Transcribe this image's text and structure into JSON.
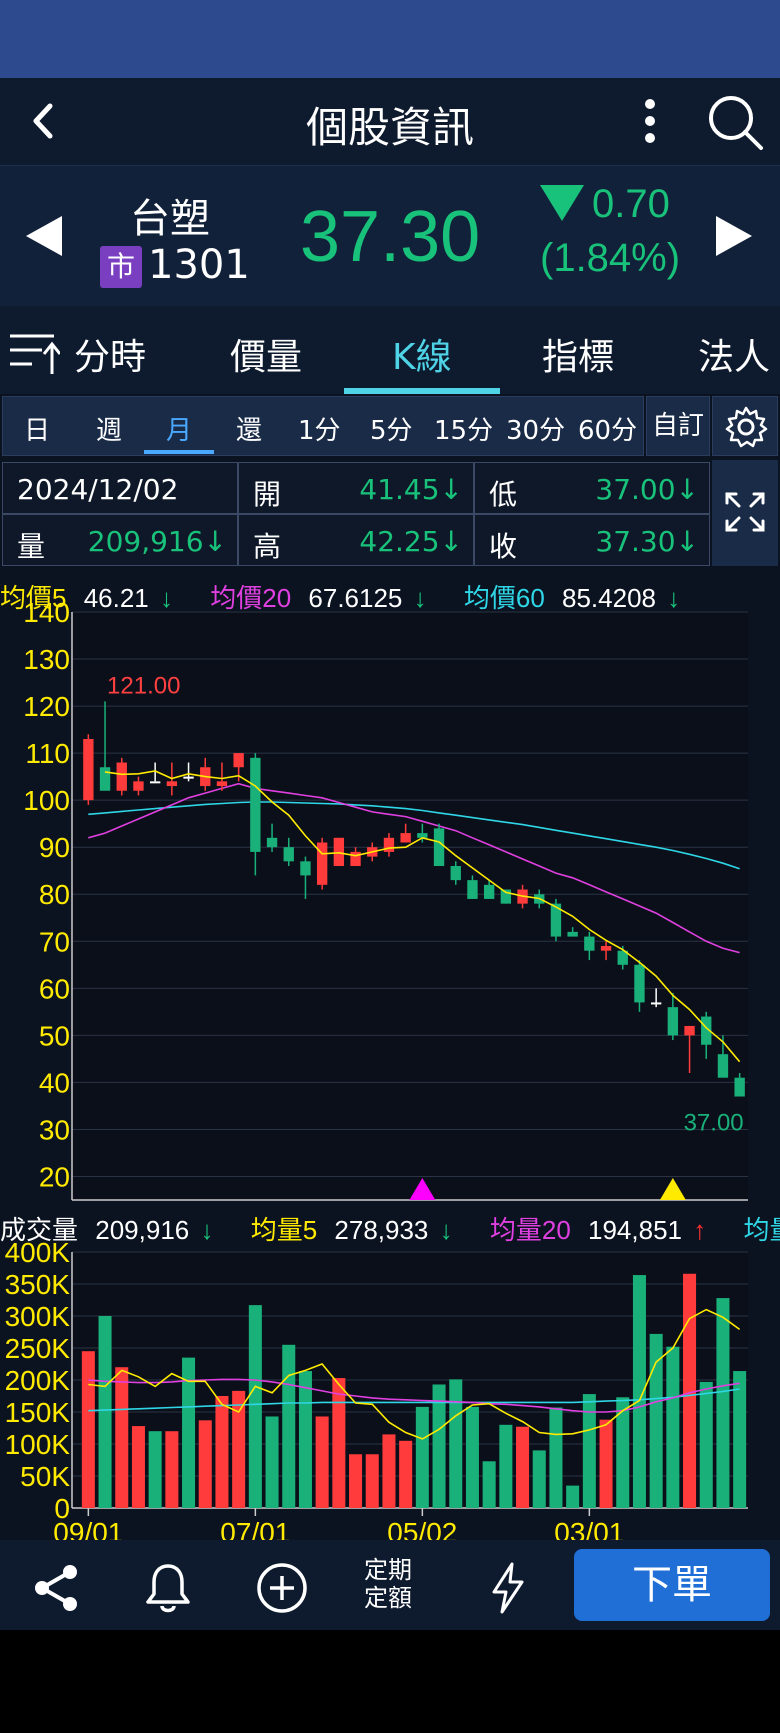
{
  "header": {
    "title": "個股資訊"
  },
  "stock": {
    "name": "台塑",
    "market": "市",
    "code": "1301",
    "price": "37.30",
    "change": "0.70",
    "change_pct": "(1.84%)"
  },
  "tabs": [
    "分時",
    "價量",
    "K線",
    "指標",
    "法人"
  ],
  "active_tab": "K線",
  "periods": [
    "日",
    "週",
    "月",
    "還",
    "1分",
    "5分",
    "15分",
    "30分",
    "60分"
  ],
  "active_period": "月",
  "custom_label": "自訂",
  "info": {
    "date": "2024/12/02",
    "volume_label": "量",
    "volume": "209,916↓",
    "open_label": "開",
    "open": "41.45↓",
    "high_label": "高",
    "high": "42.25↓",
    "low_label": "低",
    "low": "37.00↓",
    "close_label": "收",
    "close": "37.30↓"
  },
  "ma_legend": [
    {
      "label": "均價5",
      "value": "46.21",
      "arrow": "↓",
      "color": "#ffea00"
    },
    {
      "label": "均價20",
      "value": "67.6125",
      "arrow": "↓",
      "color": "#e040e0"
    },
    {
      "label": "均價60",
      "value": "85.4208",
      "arrow": "↓",
      "color": "#2fd6e6"
    }
  ],
  "vol_legend": [
    {
      "label": "成交量",
      "value": "209,916",
      "arrow": "↓",
      "color": "#ffffff",
      "arrow_color": "#19c27a"
    },
    {
      "label": "均量5",
      "value": "278,933",
      "arrow": "↓",
      "color": "#ffea00",
      "arrow_color": "#19c27a"
    },
    {
      "label": "均量20",
      "value": "194,851",
      "arrow": "↑",
      "color": "#e040e0",
      "arrow_color": "#ff3030"
    },
    {
      "label": "均量",
      "value": "",
      "arrow": "",
      "color": "#2fd6e6",
      "arrow_color": "#2fd6e6"
    }
  ],
  "colors": {
    "up": "#ff3b3b",
    "down": "#19b07a",
    "ma5": "#ffea00",
    "ma20": "#e040e0",
    "ma60": "#2fd6e6",
    "axis": "#ffea00"
  },
  "chart_data": {
    "type": "candlestick",
    "price_axis": {
      "min": 15,
      "max": 140,
      "ticks": [
        20,
        30,
        40,
        50,
        60,
        70,
        80,
        90,
        100,
        110,
        120,
        130,
        140
      ]
    },
    "volume_axis": {
      "min": 0,
      "max": 400000,
      "ticks": [
        "0",
        "50K",
        "100K",
        "150K",
        "200K",
        "250K",
        "300K",
        "350K",
        "400K"
      ]
    },
    "x_labels": [
      {
        "label": "09/01",
        "index": 0
      },
      {
        "label": "07/01",
        "index": 10
      },
      {
        "label": "05/02",
        "index": 20
      },
      {
        "label": "03/01",
        "index": 30
      }
    ],
    "annotations": {
      "high": "121.00",
      "low": "37.00"
    },
    "markers": [
      {
        "index": 20,
        "color": "#ff00ff"
      },
      {
        "index": 35,
        "color": "#ffea00"
      }
    ],
    "candles": [
      [
        100,
        114,
        99,
        113
      ],
      [
        107,
        121,
        103,
        102
      ],
      [
        102,
        109,
        101,
        108
      ],
      [
        102,
        105,
        101,
        104
      ],
      [
        104,
        108,
        104,
        104
      ],
      [
        103,
        108,
        101,
        104
      ],
      [
        105,
        108,
        104,
        105
      ],
      [
        103,
        109,
        102,
        107
      ],
      [
        103,
        108,
        102,
        104
      ],
      [
        107,
        110,
        104,
        110
      ],
      [
        109,
        110,
        84,
        89
      ],
      [
        92,
        95,
        89,
        90
      ],
      [
        90,
        92,
        86,
        87
      ],
      [
        87,
        88,
        79,
        84
      ],
      [
        82,
        92,
        81,
        91
      ],
      [
        86,
        92,
        86,
        92
      ],
      [
        86,
        90,
        86,
        89
      ],
      [
        88,
        91,
        87,
        90
      ],
      [
        89,
        93,
        88,
        92
      ],
      [
        91,
        95,
        91,
        93
      ],
      [
        93,
        95,
        91,
        92
      ],
      [
        94,
        95,
        86,
        86
      ],
      [
        86,
        87,
        82,
        83
      ],
      [
        83,
        84,
        79,
        79
      ],
      [
        82,
        83,
        79,
        79
      ],
      [
        81,
        81,
        78,
        78
      ],
      [
        78,
        82,
        77,
        81
      ],
      [
        80,
        81,
        77,
        78
      ],
      [
        78,
        79,
        70,
        71
      ],
      [
        72,
        73,
        71,
        71
      ],
      [
        71,
        72,
        66,
        68
      ],
      [
        68,
        70,
        66,
        69
      ],
      [
        68,
        69,
        64,
        65
      ],
      [
        65,
        66,
        55,
        57
      ],
      [
        57,
        60,
        56,
        57
      ],
      [
        56,
        59,
        49,
        50
      ],
      [
        50,
        52,
        42,
        52
      ],
      [
        54,
        55,
        45,
        48
      ],
      [
        46,
        50,
        41,
        41
      ],
      [
        41,
        42,
        37,
        37
      ]
    ],
    "volume": [
      245000,
      300000,
      220000,
      128000,
      120000,
      120000,
      235000,
      137000,
      175000,
      183000,
      317000,
      143000,
      255000,
      214000,
      143000,
      203000,
      84000,
      84000,
      115000,
      105000,
      158000,
      193000,
      201000,
      158000,
      73000,
      130000,
      127000,
      90000,
      157000,
      35000,
      178000,
      138000,
      173000,
      364000,
      272000,
      252000,
      366000,
      197000,
      328000,
      214000
    ],
    "ma5": [
      null,
      106.0,
      105.5,
      105.6,
      106.2,
      104.6,
      105.6,
      105.0,
      104.6,
      105.2,
      103.0,
      99.6,
      96.8,
      92.4,
      88.6,
      88.8,
      88.2,
      89.0,
      89.8,
      90.0,
      92.0,
      91.1,
      88.2,
      85.6,
      83.0,
      80.4,
      79.6,
      79.1,
      77.3,
      75.3,
      72.5,
      70.2,
      68.2,
      65.5,
      62.6,
      58.5,
      55.5,
      51.6,
      48.6,
      44.4
    ],
    "ma20": [
      92.0,
      93.0,
      94.5,
      96.0,
      97.5,
      99.0,
      100.5,
      101.5,
      102.5,
      103.5,
      102.5,
      102.0,
      101.5,
      101.0,
      100.5,
      99.5,
      98.5,
      97.5,
      97.0,
      96.5,
      95.5,
      94.5,
      93.5,
      92.0,
      90.5,
      89.0,
      87.5,
      86.0,
      84.5,
      83.5,
      82.0,
      80.5,
      79.0,
      77.5,
      76.0,
      74.0,
      72.0,
      70.0,
      68.5,
      67.6
    ],
    "ma60": [
      97.0,
      97.3,
      97.6,
      97.9,
      98.2,
      98.5,
      98.8,
      99.1,
      99.3,
      99.5,
      99.6,
      99.6,
      99.5,
      99.4,
      99.3,
      99.2,
      99.0,
      98.8,
      98.5,
      98.2,
      97.8,
      97.3,
      96.8,
      96.3,
      95.8,
      95.3,
      94.8,
      94.2,
      93.6,
      93.0,
      92.4,
      91.8,
      91.2,
      90.6,
      90.0,
      89.3,
      88.5,
      87.6,
      86.6,
      85.4
    ],
    "vol_ma5": [
      193000,
      190000,
      215000,
      205000,
      190000,
      210000,
      198000,
      198000,
      162000,
      150000,
      190000,
      180000,
      207000,
      215000,
      225000,
      193000,
      164000,
      162000,
      134000,
      118000,
      108000,
      123000,
      144000,
      161000,
      163000,
      148000,
      135000,
      118000,
      115000,
      116000,
      122000,
      130000,
      152000,
      168000,
      228000,
      250000,
      296000,
      310000,
      298000,
      279000
    ],
    "vol_ma20": [
      200000,
      198000,
      197000,
      196000,
      196000,
      197000,
      199000,
      200000,
      201000,
      201000,
      200000,
      197000,
      193000,
      188000,
      183000,
      178000,
      175000,
      172000,
      170000,
      169000,
      168000,
      167000,
      166000,
      165000,
      163000,
      162000,
      160000,
      158000,
      155000,
      152000,
      150000,
      150000,
      152000,
      158000,
      166000,
      172000,
      180000,
      186000,
      191000,
      194851
    ],
    "vol_ma60": [
      152000,
      153000,
      154000,
      155000,
      156000,
      157000,
      158000,
      159000,
      160000,
      161000,
      162000,
      163000,
      164000,
      164000,
      165000,
      165000,
      165000,
      165000,
      165000,
      165000,
      165000,
      165000,
      165000,
      165000,
      165000,
      165000,
      165000,
      165000,
      165000,
      165000,
      166000,
      167000,
      168000,
      169000,
      171000,
      173000,
      176000,
      179000,
      182000,
      186000
    ]
  },
  "bottom": {
    "dd_line1": "定期",
    "dd_line2": "定額",
    "order": "下單"
  }
}
